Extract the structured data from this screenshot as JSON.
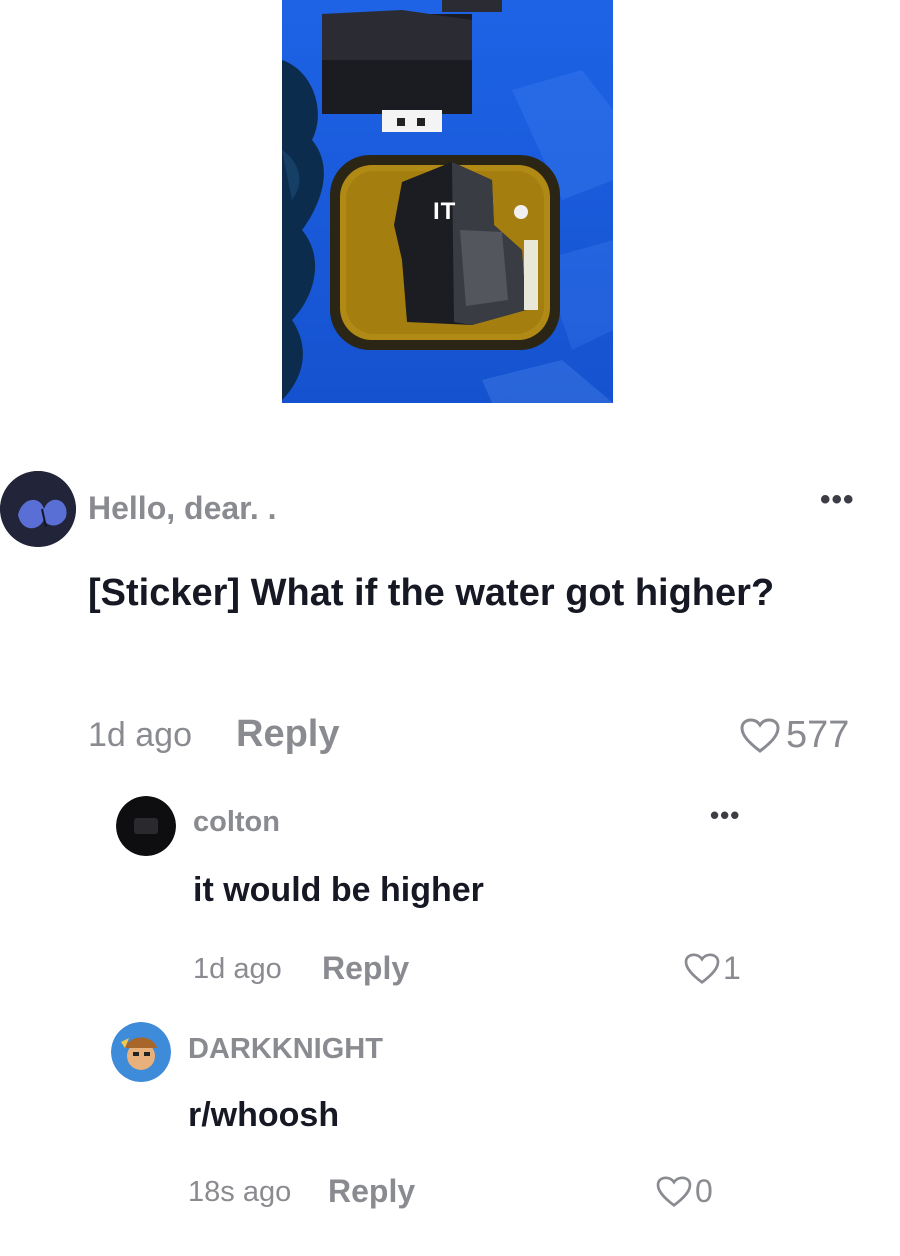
{
  "media": {
    "overlay_text": "IT"
  },
  "comment": {
    "username": "Hello, dear. .",
    "text": "[Sticker] What if the water got higher?",
    "time": "1d ago",
    "reply_label": "Reply",
    "likes": "577",
    "more_label": "•••"
  },
  "replies": [
    {
      "username": "colton",
      "text": "it would be higher",
      "time": "1d ago",
      "reply_label": "Reply",
      "likes": "1",
      "more_label": "•••"
    },
    {
      "username": "DARKKNIGHT",
      "text": "r/whoosh",
      "time": "18s ago",
      "reply_label": "Reply",
      "likes": "0"
    }
  ],
  "colors": {
    "muted_text": "#8a8b91",
    "primary_text": "#161823",
    "water": "#1a5fe0"
  },
  "icons": {
    "like": "heart-outline-icon",
    "more": "more-horizontal-icon"
  }
}
